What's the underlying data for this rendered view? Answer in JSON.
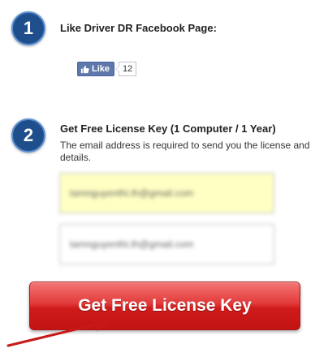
{
  "step1": {
    "number": "1",
    "title": "Like Driver DR Facebook Page:",
    "like_label": "Like",
    "like_count": "12"
  },
  "step2": {
    "number": "2",
    "title": "Get Free License Key (1 Computer / 1 Year)",
    "description": "The email address is required to send you the license and details.",
    "email_value": "tamnguyenthi.th@gmail.com",
    "confirm_email_value": "tamnguyenthi.th@gmail.com"
  },
  "cta": {
    "label": "Get Free License Key"
  },
  "colors": {
    "badge": "#1f4e8c",
    "facebook": "#5f78ab",
    "highlight_field": "#ffffc4",
    "cta_red": "#e23a3a",
    "arrow_red": "#c81818"
  },
  "icons": {
    "like": "thumbs-up-icon",
    "pointer": "red-arrow-icon"
  }
}
